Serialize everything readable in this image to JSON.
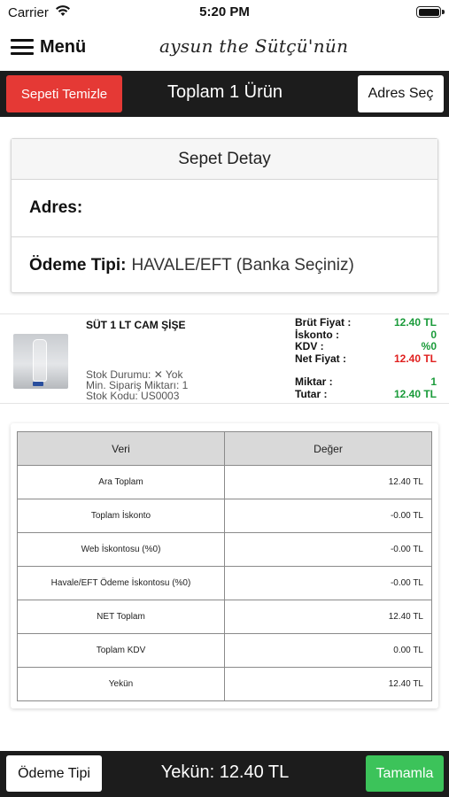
{
  "status_bar": {
    "carrier": "Carrier",
    "time": "5:20 PM"
  },
  "nav": {
    "menu_label": "Menü",
    "logo_text": "aysun the Sütçü'nün"
  },
  "header": {
    "clear_label": "Sepeti Temizle",
    "title": "Toplam 1 Ürün",
    "address_label": "Adres Seç"
  },
  "detail": {
    "title": "Sepet Detay",
    "address_label": "Adres:",
    "address_value": "",
    "payment_label": "Ödeme Tipi:",
    "payment_value": "HAVALE/EFT (Banka Seçiniz)"
  },
  "product": {
    "name": "SÜT 1 LT CAM ŞİŞE",
    "stock": "Stok Durumu: ✕ Yok",
    "min_order": "Min. Sipariş Miktarı: 1",
    "code": "Stok Kodu: US0003",
    "gross_label": "Brüt Fiyat :",
    "gross_value": "12.40 TL",
    "discount_label": "İskonto :",
    "discount_value": "0",
    "vat_label": "KDV :",
    "vat_value": "%0",
    "net_label": "Net Fiyat :",
    "net_value": "12.40 TL",
    "qty_label": "Miktar :",
    "qty_value": "1",
    "amount_label": "Tutar :",
    "amount_value": "12.40 TL"
  },
  "summary": {
    "col_headers": [
      "Veri",
      "Değer"
    ],
    "rows": [
      {
        "label": "Ara Toplam",
        "value": "12.40 TL"
      },
      {
        "label": "Toplam İskonto",
        "value": "-0.00 TL"
      },
      {
        "label": "Web İskontosu (%0)",
        "value": "-0.00 TL"
      },
      {
        "label": "Havale/EFT Ödeme İskontosu (%0)",
        "value": "-0.00 TL"
      },
      {
        "label": "NET Toplam",
        "value": "12.40 TL"
      },
      {
        "label": "Toplam KDV",
        "value": "0.00 TL"
      },
      {
        "label": "Yekün",
        "value": "12.40 TL"
      }
    ]
  },
  "footer": {
    "payment_button": "Ödeme Tipi",
    "total": "Yekün: 12.40 TL",
    "complete_button": "Tamamla"
  },
  "colors": {
    "danger": "#e53935",
    "success": "#3cc35a",
    "bar": "#1c1c1c",
    "price_green": "#1a9b3a",
    "price_red": "#e0201f"
  },
  "icons": [
    "wifi-icon",
    "battery-icon",
    "hamburger-icon",
    "product-image"
  ]
}
